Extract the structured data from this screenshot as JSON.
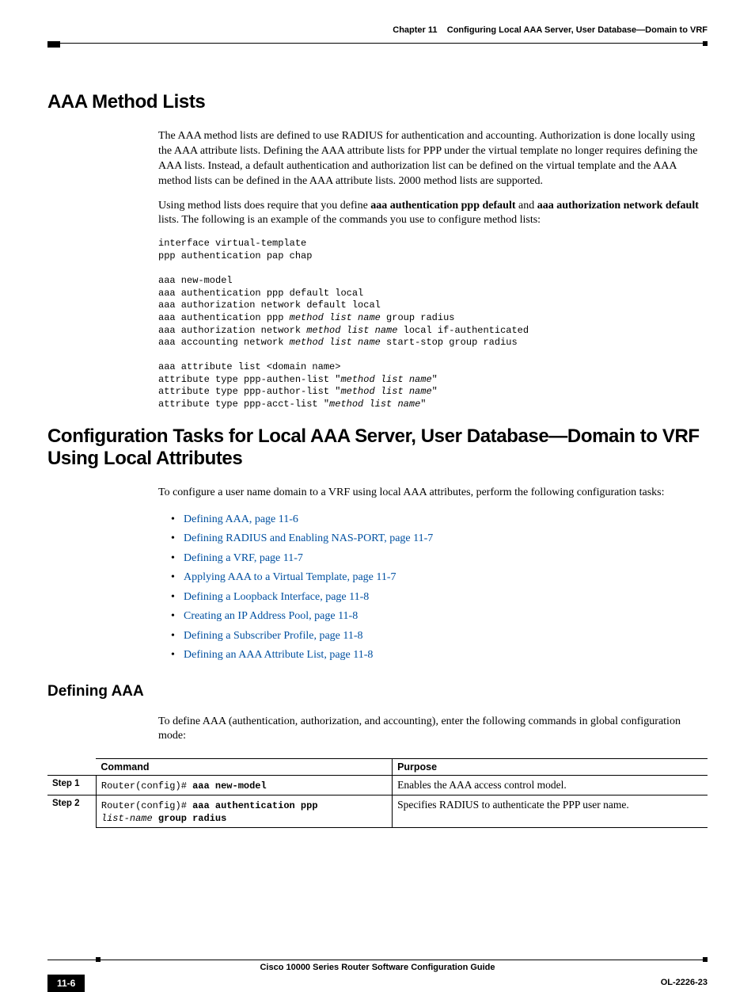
{
  "header": {
    "chapter": "Chapter 11",
    "title": "Configuring Local AAA Server, User Database—Domain to VRF"
  },
  "sections": {
    "s1": {
      "heading": "AAA Method Lists",
      "p1": "The AAA method lists are defined to use RADIUS for authentication and accounting. Authorization is done locally using the AAA attribute lists. Defining the AAA attribute lists for PPP under the virtual template no longer requires defining the AAA lists. Instead, a default authentication and authorization list can be defined on the virtual template and the AAA method lists can be defined in the AAA attribute lists. 2000 method lists are supported.",
      "p2a": "Using method lists does require that you define ",
      "p2b1": "aaa authentication ppp default",
      "p2c": " and ",
      "p2b2": "aaa authorization network default",
      "p2d": " lists. The following is an example of the commands you use to configure method lists:",
      "code": {
        "l1": "interface virtual-template",
        "l2": "ppp authentication pap chap",
        "l3": "aaa new-model",
        "l4": "aaa authentication ppp default local",
        "l5": "aaa authorization network default local",
        "l6a": "aaa authentication ppp ",
        "l6i": "method list name",
        "l6b": " group radius",
        "l7a": "aaa authorization network ",
        "l7i": "method list name",
        "l7b": " local if-authenticated",
        "l8a": "aaa accounting network ",
        "l8i": "method list name",
        "l8b": " start-stop group radius",
        "l9": "aaa attribute list <domain name>",
        "l10a": "attribute type ppp-authen-list \"",
        "l10i": "method list name",
        "l10b": "\"",
        "l11a": "attribute type ppp-author-list \"",
        "l11i": "method list name",
        "l11b": "\"",
        "l12a": "attribute type ppp-acct-list \"",
        "l12i": "method list name",
        "l12b": "\""
      }
    },
    "s2": {
      "heading": "Configuration Tasks for Local AAA Server, User Database—Domain to VRF Using Local Attributes",
      "p1": "To configure a user name domain to a VRF using local AAA attributes, perform the following configuration tasks:",
      "links": {
        "l1": "Defining AAA, page 11-6",
        "l2": "Defining RADIUS and Enabling NAS-PORT, page 11-7",
        "l3": "Defining a VRF, page 11-7",
        "l4": "Applying AAA to a Virtual Template, page 11-7",
        "l5": "Defining a Loopback Interface, page 11-8",
        "l6": "Creating an IP Address Pool, page 11-8",
        "l7": "Defining a Subscriber Profile, page 11-8",
        "l8": "Defining an AAA Attribute List, page 11-8"
      }
    },
    "s3": {
      "heading": "Defining AAA",
      "p1": "To define AAA (authentication, authorization, and accounting), enter the following commands in global configuration mode:",
      "table": {
        "h1": "Command",
        "h2": "Purpose",
        "r1": {
          "step": "Step 1",
          "cmd_pre": "Router(config)# ",
          "cmd_b": "aaa new-model",
          "purpose": "Enables the AAA access control model."
        },
        "r2": {
          "step": "Step 2",
          "cmd_pre": "Router(config)# ",
          "cmd_b1": "aaa authentication ppp",
          "cmd_i": "list-name",
          "cmd_b2": " group radius",
          "purpose": "Specifies RADIUS to authenticate the PPP user name."
        }
      }
    }
  },
  "footer": {
    "title": "Cisco 10000 Series Router Software Configuration Guide",
    "page": "11-6",
    "docid": "OL-2226-23"
  }
}
